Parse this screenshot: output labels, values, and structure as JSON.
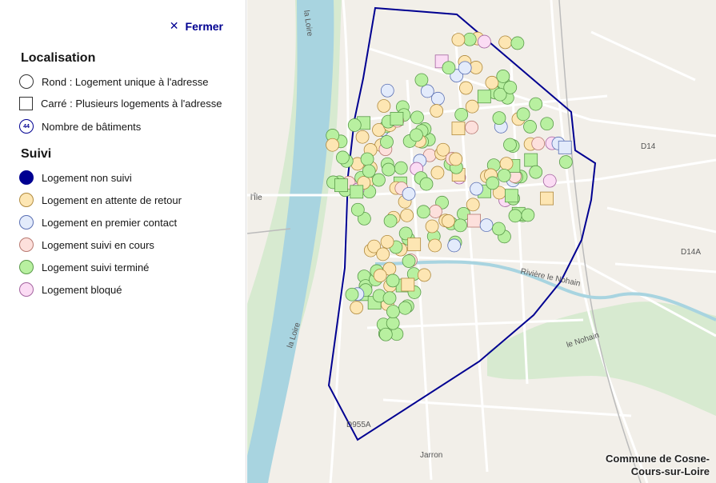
{
  "legend": {
    "close_label": "Fermer",
    "localisation_title": "Localisation",
    "localisation_items": [
      {
        "shape": "circle",
        "label": "Rond : Logement unique à l'adresse"
      },
      {
        "shape": "square",
        "label": "Carré : Plusieurs logements à l'adresse"
      },
      {
        "shape": "count",
        "badge": "44",
        "label": "Nombre de bâtiments"
      }
    ],
    "suivi_title": "Suivi",
    "suivi_items": [
      {
        "label": "Logement non suivi",
        "fill": "#000091",
        "stroke": "#000091"
      },
      {
        "label": "Logement en attente de retour",
        "fill": "#fde6b3",
        "stroke": "#b08a3e"
      },
      {
        "label": "Logement en premier contact",
        "fill": "#e3ebfb",
        "stroke": "#5a6fb3"
      },
      {
        "label": "Logement suivi en cours",
        "fill": "#fde0dc",
        "stroke": "#b87a72"
      },
      {
        "label": "Logement suivi terminé",
        "fill": "#b8f0a0",
        "stroke": "#5a9a4a"
      },
      {
        "label": "Logement bloqué",
        "fill": "#fbdcf4",
        "stroke": "#a464a0"
      }
    ]
  },
  "map": {
    "commune_line1": "Commune de Cosne-",
    "commune_line2": "Cours-sur-Loire",
    "place_labels": [
      "la Loire",
      "l'Île",
      "la Loire",
      "D14",
      "D14A",
      "Rivière le Nohain",
      "le Nohain",
      "D955A",
      "Jarron"
    ],
    "boundary_color": "#000091",
    "water_color": "#a8d4e0",
    "green_color": "#d7ead0"
  }
}
